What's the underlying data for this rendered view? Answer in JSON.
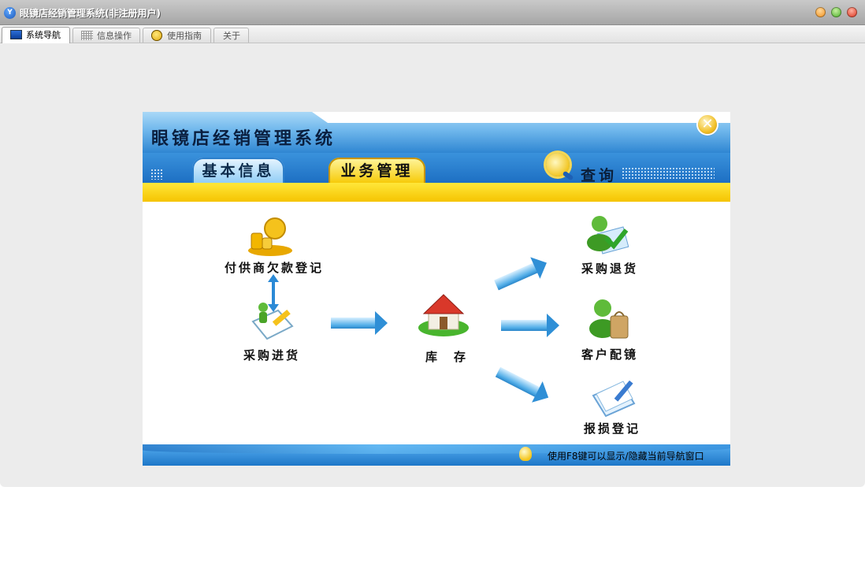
{
  "window": {
    "title": "眼镜店经销管理系统(非注册用户)",
    "app_icon": "app-logo-icon",
    "controls": [
      "minimize-icon",
      "maximize-icon",
      "close-icon"
    ]
  },
  "tabs": [
    {
      "label": "系统导航",
      "icon": "monitor-icon",
      "active": true
    },
    {
      "label": "信息操作",
      "icon": "grid-icon",
      "active": false
    },
    {
      "label": "使用指南",
      "icon": "smiley-icon",
      "active": false
    },
    {
      "label": "关于",
      "icon": "",
      "active": false
    }
  ],
  "panel": {
    "title": "眼镜店经销管理系统",
    "close_icon": "close-circle-icon",
    "tabs": [
      "基本信息",
      "业务管理"
    ],
    "active_tab": "业务管理",
    "search_label": "查询",
    "nodes": {
      "supplier_payment": "付供商欠款登记",
      "purchase_in": "采购进货",
      "inventory": "库　存",
      "purchase_return": "采购退货",
      "customer_fitting": "客户配镜",
      "damage_register": "报损登记"
    },
    "footer_hint": "使用F8键可以显示/隐藏当前导航窗口"
  },
  "colors": {
    "header_blue": "#2f86d2",
    "accent_yellow": "#f6c800",
    "arrow_blue": "#53aee8",
    "window_bg": "#ececec"
  }
}
